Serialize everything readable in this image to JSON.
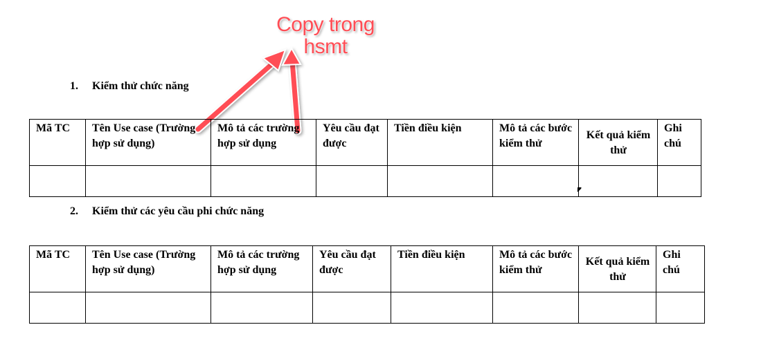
{
  "annotation": {
    "line1": "Copy trong",
    "line2": "hsmt",
    "color": "#ff4d55"
  },
  "sections": [
    {
      "number": "1.",
      "title": "Kiểm thử chức năng",
      "columns": [
        "Mã TC",
        "Tên Use case (Trường hợp sử dụng)",
        "Mô tả các trường hợp sử dụng",
        "Yêu cầu đạt được",
        "Tiền điều kiện",
        "Mô tả các bước kiểm thử",
        "Kết quả kiểm thử",
        "Ghi chú"
      ]
    },
    {
      "number": "2.",
      "title": "Kiểm thử các yêu cầu phi chức năng",
      "columns": [
        "Mã TC",
        "Tên Use case (Trường hợp sử dụng)",
        "Mô tả các trường hợp sử dụng",
        "Yêu cầu đạt được",
        "Tiền điều kiện",
        "Mô tả các bước kiểm thử",
        "Kết quả kiểm thử",
        "Ghi chú"
      ]
    }
  ]
}
